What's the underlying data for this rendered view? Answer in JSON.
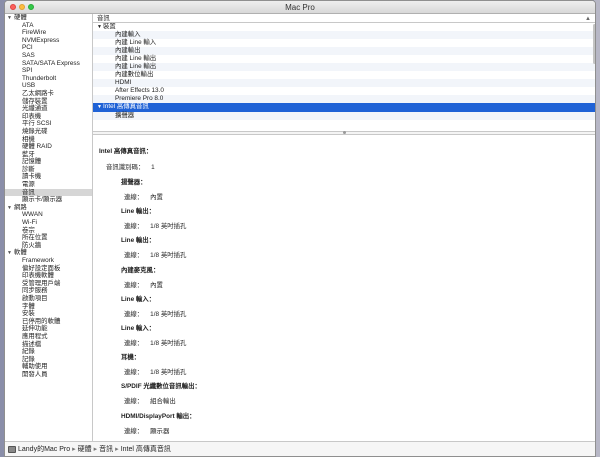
{
  "window": {
    "title": "Mac Pro"
  },
  "sidebar": {
    "sections": [
      {
        "label": "硬體",
        "items": [
          "ATA",
          "FireWire",
          "NVMExpress",
          "PCI",
          "SAS",
          "SATA/SATA Express",
          "SPI",
          "Thunderbolt",
          "USB",
          "乙太網路卡",
          "儲存裝置",
          "光纖通道",
          "印表機",
          "平行 SCSI",
          "燒錄光碟",
          "相機",
          "硬體 RAID",
          "藍牙",
          "記憶體",
          "診斷",
          "讀卡機",
          "電源",
          "音訊",
          "顯示卡/顯示器"
        ]
      },
      {
        "label": "網路",
        "items": [
          "WWAN",
          "Wi-Fi",
          "卷宗",
          "所在位置",
          "防火牆"
        ]
      },
      {
        "label": "軟體",
        "items": [
          "Framework",
          "偏好設定面板",
          "印表機軟體",
          "受管理用戶端",
          "同步服務",
          "啟動項目",
          "字體",
          "安裝",
          "已停用的軟體",
          "延伸功能",
          "應用程式",
          "描述檔",
          "紀錄",
          "記錄",
          "輔助使用",
          "開發人員"
        ]
      }
    ],
    "selected": "音訊"
  },
  "tree": {
    "column_header": "音訊",
    "rows": [
      {
        "label": "裝置",
        "type": "parent"
      },
      {
        "label": "內建輸入",
        "type": "child"
      },
      {
        "label": "內建 Line 輸入",
        "type": "child"
      },
      {
        "label": "內建輸出",
        "type": "child"
      },
      {
        "label": "內建 Line 輸出",
        "type": "child"
      },
      {
        "label": "內建 Line 輸出",
        "type": "child"
      },
      {
        "label": "內建數位輸出",
        "type": "child"
      },
      {
        "label": "HDMI",
        "type": "child"
      },
      {
        "label": "After Effects 13.0",
        "type": "child"
      },
      {
        "label": "Premiere Pro 8.0",
        "type": "child"
      },
      {
        "label": "Intel 高傳真音訊",
        "type": "parent",
        "selected": true
      },
      {
        "label": "擴聲器",
        "type": "child"
      }
    ]
  },
  "detail": {
    "title": "Intel 高傳真音訊：",
    "id_label": "音訊識別碼：",
    "id_value": "1",
    "ports": [
      {
        "name": "揚聲器：",
        "key": "連線：",
        "value": "內置"
      },
      {
        "name": "Line 輸出：",
        "key": "連線：",
        "value": "1/8 英吋插孔"
      },
      {
        "name": "Line 輸出：",
        "key": "連線：",
        "value": "1/8 英吋插孔"
      },
      {
        "name": "內建麥克風：",
        "key": "連線：",
        "value": "內置"
      },
      {
        "name": "Line 輸入：",
        "key": "連線：",
        "value": "1/8 英吋插孔"
      },
      {
        "name": "Line 輸入：",
        "key": "連線：",
        "value": "1/8 英吋插孔"
      },
      {
        "name": "耳機：",
        "key": "連線：",
        "value": "1/8 英吋插孔"
      },
      {
        "name": "S/PDIF 光纖數位音訊輸出：",
        "key": "連線：",
        "value": "組合輸出"
      },
      {
        "name": "HDMI/DisplayPort 輸出：",
        "key": "連線：",
        "value": "顯示器"
      }
    ]
  },
  "pathbar": {
    "items": [
      "Landy的Mac Pro",
      "硬體",
      "音訊",
      "Intel 高傳真音訊"
    ]
  }
}
